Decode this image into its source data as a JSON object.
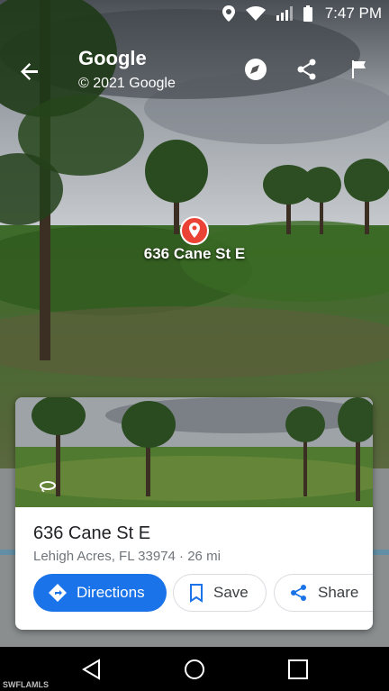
{
  "status_bar": {
    "time": "7:47 PM",
    "icons": [
      "location-icon",
      "wifi-icon",
      "signal-icon",
      "battery-icon"
    ]
  },
  "header": {
    "title": "Google",
    "subtitle": "© 2021 Google",
    "actions": [
      "compass-icon",
      "share-icon",
      "flag-icon"
    ]
  },
  "map_pin": {
    "label": "636 Cane St E",
    "icon": "location-pin-icon"
  },
  "place_card": {
    "name": "636 Cane St E",
    "info": "Lehigh Acres, FL 33974 · 26 mi",
    "thumbnail_icon": "360-view-icon",
    "buttons": {
      "directions": "Directions",
      "save": "Save",
      "share": "Share"
    }
  },
  "nav_bar": {
    "buttons": [
      "back-triangle-icon",
      "home-circle-icon",
      "recents-square-icon"
    ]
  },
  "watermark": "SWFLAMLS",
  "colors": {
    "accent": "#1a73e8",
    "pin": "#ea4335"
  }
}
